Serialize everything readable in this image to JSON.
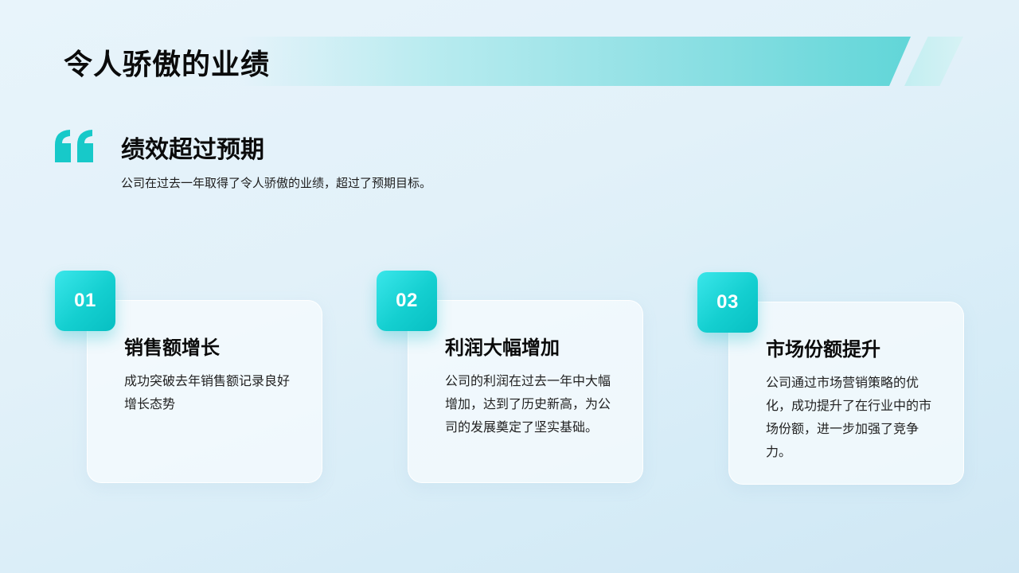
{
  "page": {
    "title": "令人骄傲的业绩"
  },
  "quote": {
    "icon": "quote-icon",
    "heading": "绩效超过预期",
    "text": "公司在过去一年取得了令人骄傲的业绩，超过了预期目标。"
  },
  "cards": [
    {
      "number": "01",
      "title": "销售额增长",
      "description": "成功突破去年销售额记录良好增长态势"
    },
    {
      "number": "02",
      "title": "利润大幅增加",
      "description": "公司的利润在过去一年中大幅增加，达到了历史新高，为公司的发展奠定了坚实基础。"
    },
    {
      "number": "03",
      "title": "市场份额提升",
      "description": "公司通过市场营销策略的优化，成功提升了在行业中的市场份额，进一步加强了竞争力。"
    }
  ],
  "colors": {
    "accent": "#14cfd0",
    "accent_light": "#3ae6ea",
    "banner_end": "#61d6d8",
    "text_primary": "#0b0b0b",
    "background": "#e2f1f9"
  }
}
